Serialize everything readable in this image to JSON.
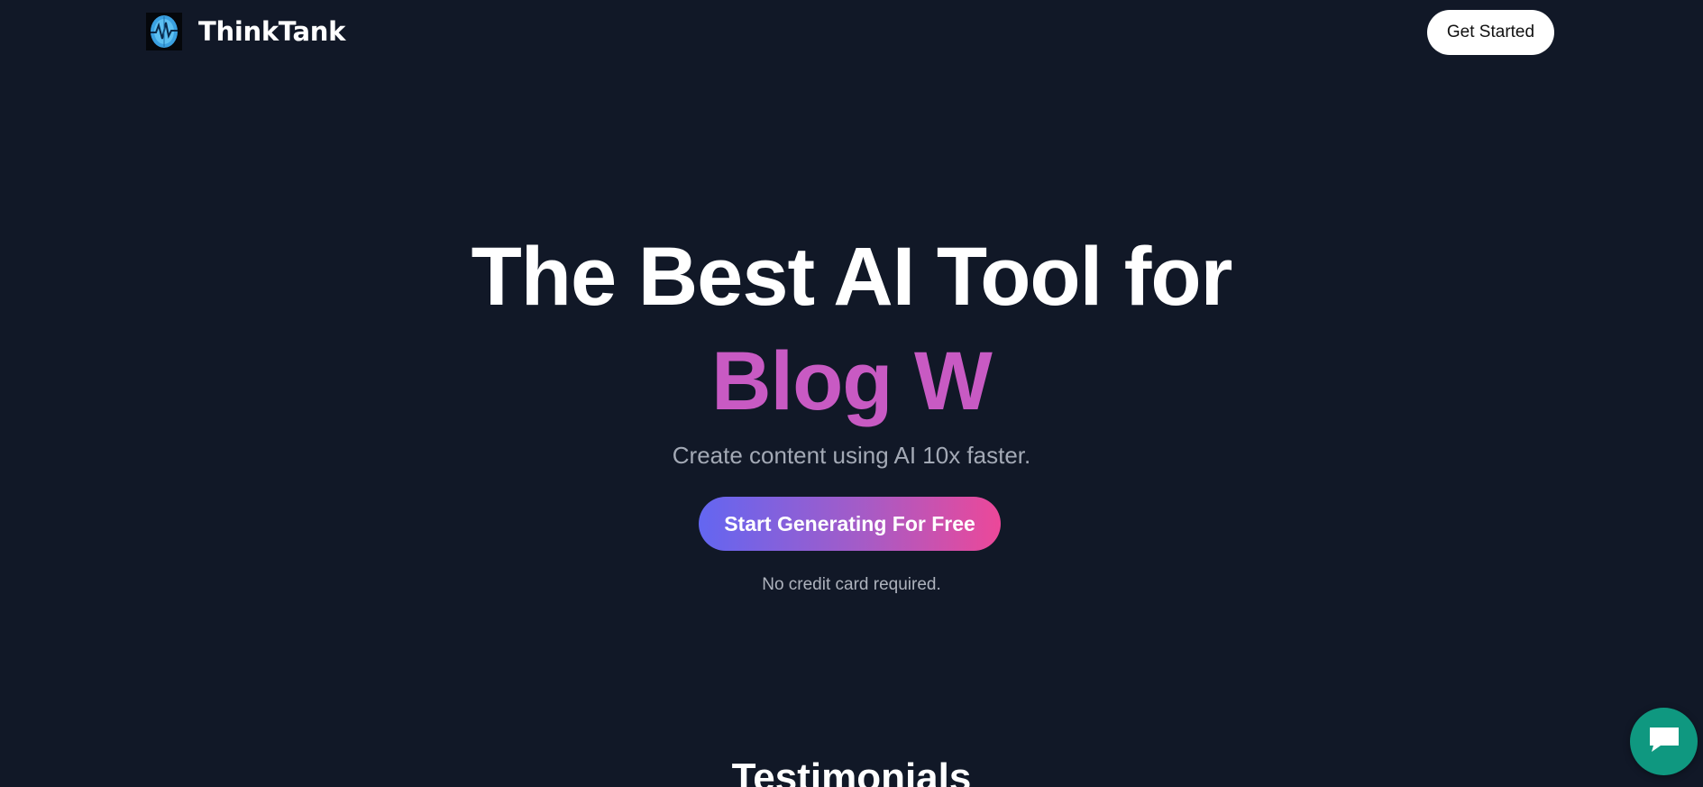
{
  "header": {
    "brand_name": "ThinkTank",
    "cta_label": "Get Started"
  },
  "hero": {
    "title": "The Best AI Tool for",
    "typed_text": "Blog W",
    "subtitle": "Create content using AI 10x faster.",
    "cta_label": "Start Generating For Free",
    "note": "No credit card required."
  },
  "sections": {
    "testimonials_heading": "Testimonials"
  },
  "chat": {
    "icon": "chat-bubble-icon"
  },
  "colors": {
    "background": "#111827",
    "accent_pink": "#c85ac3",
    "gradient_start": "#6366f1",
    "gradient_end": "#ec4899",
    "chat_green": "#0f9880"
  }
}
